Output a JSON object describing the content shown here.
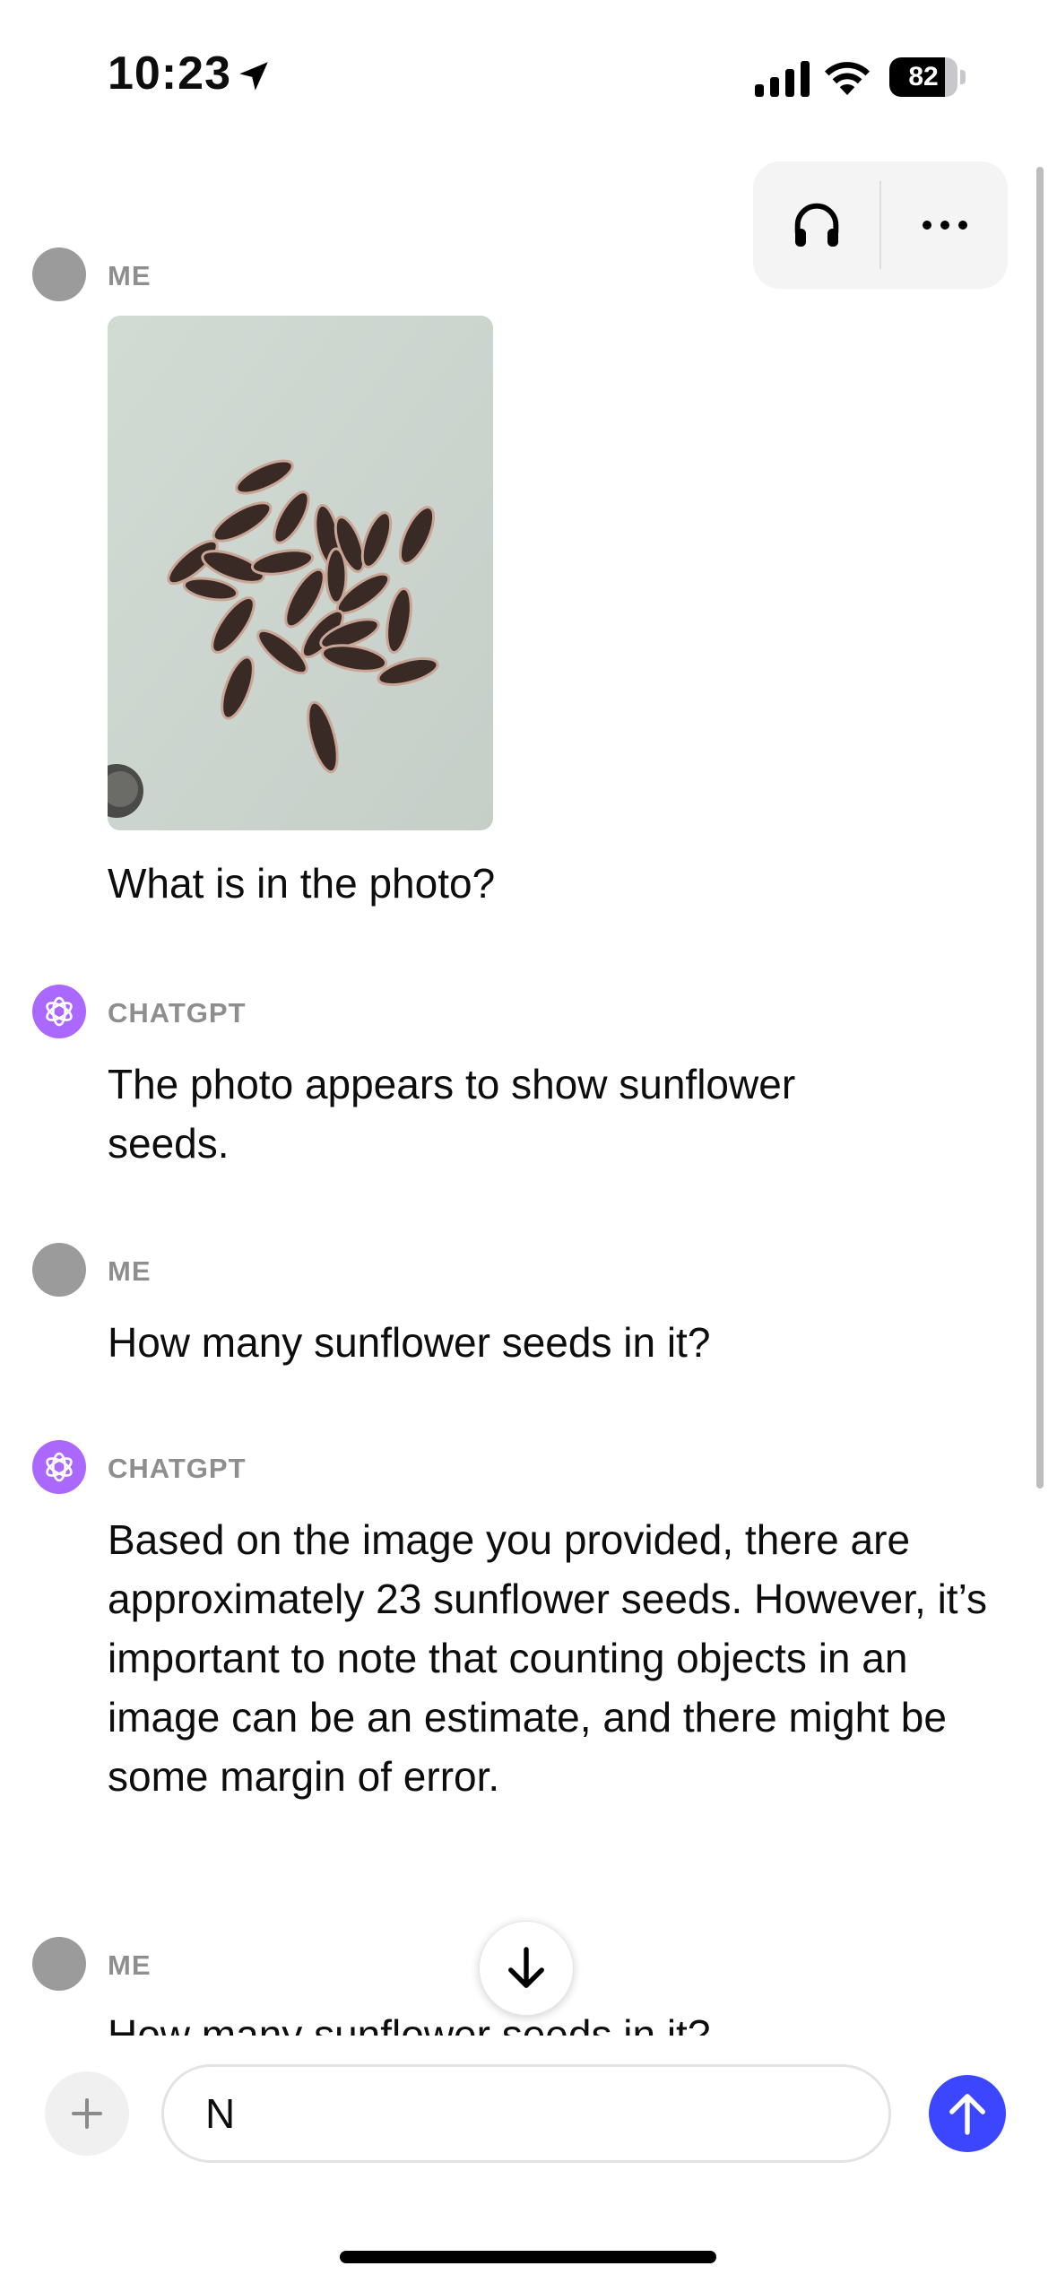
{
  "status_bar": {
    "time": "10:23",
    "battery": "82",
    "battery_level": 0.82
  },
  "toolbar": {
    "headphones_icon": "headphones-icon",
    "more_icon": "more-icon"
  },
  "messages": [
    {
      "author": "ME",
      "image": "sunflower-seeds-photo",
      "text": "What is in the photo?"
    },
    {
      "author": "CHATGPT",
      "text": "The photo appears to show sunflower seeds."
    },
    {
      "author": "ME",
      "text": "How many sunflower seeds in it?"
    },
    {
      "author": "CHATGPT",
      "text": "Based on the image you provided, there are approximately 23 sunflower seeds. However, it’s important to note that counting objects in an image can be an estimate, and there might be some margin of error."
    },
    {
      "author": "ME",
      "text": "How many sunflower seeds in it?"
    }
  ],
  "composer": {
    "value": "N"
  },
  "colors": {
    "accent": "#3c46ff",
    "gpt_avatar": "#ab68ff",
    "author_label": "#8e8e8e"
  }
}
